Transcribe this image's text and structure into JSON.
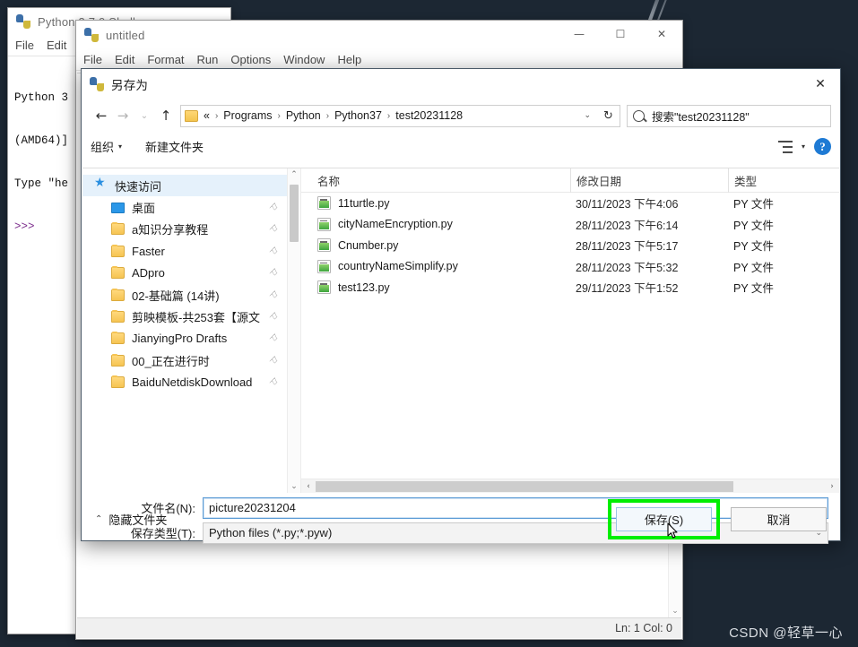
{
  "desktop": {
    "background_color": "#1c2733",
    "watermark": "CSDN @轻草一心"
  },
  "shell_window": {
    "title": "Python 3.7.0 Shell",
    "icon": "python-icon",
    "menu": [
      "File",
      "Edit"
    ],
    "content_lines": [
      "Python 3",
      "(AMD64)]",
      "Type \"he",
      ">>>"
    ]
  },
  "editor_window": {
    "title": "untitled",
    "icon": "python-icon",
    "menu": [
      "File",
      "Edit",
      "Format",
      "Run",
      "Options",
      "Window",
      "Help"
    ],
    "window_buttons": {
      "minimize": "—",
      "maximize": "☐",
      "close": "✕"
    },
    "status": "Ln: 1  Col: 0"
  },
  "dialog": {
    "title": "另存为",
    "icon": "python-icon",
    "close_label": "✕",
    "nav": {
      "back": "←",
      "forward": "→",
      "recent": "⌄",
      "up": "↑",
      "refresh": "↻",
      "dropdown_caret": "⌄"
    },
    "breadcrumb": {
      "prefix": "«",
      "items": [
        "Programs",
        "Python",
        "Python37",
        "test20231128"
      ],
      "separator": "›"
    },
    "search": {
      "icon": "search-icon",
      "placeholder": "搜索\"test20231128\""
    },
    "commandbar": {
      "organize": "组织",
      "organize_caret": "▾",
      "new_folder": "新建文件夹",
      "view_icon": "list-view-icon",
      "view_caret": "▾",
      "help_icon": "help-icon",
      "help_label": "?"
    },
    "nav_pane": {
      "quick_access": {
        "label": "快速访问",
        "icon": "star-icon"
      },
      "items": [
        {
          "label": "桌面",
          "icon": "monitor-icon",
          "pinned": true
        },
        {
          "label": "a知识分享教程",
          "icon": "folder-icon",
          "pinned": true
        },
        {
          "label": "Faster",
          "icon": "folder-icon",
          "pinned": true
        },
        {
          "label": "ADpro",
          "icon": "folder-icon",
          "pinned": true
        },
        {
          "label": "02-基础篇 (14讲)",
          "icon": "folder-icon",
          "pinned": true
        },
        {
          "label": "剪映模板-共253套【源文",
          "icon": "folder-icon",
          "pinned": true
        },
        {
          "label": "JianyingPro Drafts",
          "icon": "folder-icon",
          "pinned": true
        },
        {
          "label": "00_正在进行时",
          "icon": "folder-icon",
          "pinned": true
        },
        {
          "label": "BaiduNetdiskDownload",
          "icon": "folder-icon",
          "pinned": true
        }
      ],
      "pin_glyph": "⚐"
    },
    "file_list": {
      "columns": [
        "名称",
        "修改日期",
        "类型"
      ],
      "rows": [
        {
          "name": "11turtle.py",
          "date": "30/11/2023 下午4:06",
          "type": "PY 文件",
          "icon": "py-file-icon"
        },
        {
          "name": "cityNameEncryption.py",
          "date": "28/11/2023 下午6:14",
          "type": "PY 文件",
          "icon": "py-file-icon"
        },
        {
          "name": "Cnumber.py",
          "date": "28/11/2023 下午5:17",
          "type": "PY 文件",
          "icon": "py-file-icon"
        },
        {
          "name": "countryNameSimplify.py",
          "date": "28/11/2023 下午5:32",
          "type": "PY 文件",
          "icon": "py-file-icon"
        },
        {
          "name": "test123.py",
          "date": "29/11/2023 下午1:52",
          "type": "PY 文件",
          "icon": "py-file-icon"
        }
      ]
    },
    "scrollbars": {
      "up_arrow": "⌃",
      "down_arrow": "⌄",
      "left_arrow": "‹",
      "right_arrow": "›"
    },
    "form": {
      "filename_label": "文件名(N):",
      "filename_value": "picture20231204",
      "filetype_label": "保存类型(T):",
      "filetype_value": "Python files (*.py;*.pyw)",
      "caret": "⌄"
    },
    "footer": {
      "hide_folders_caret": "⌃",
      "hide_folders": "隐藏文件夹",
      "save_button": "保存(S)",
      "cancel_button": "取消",
      "highlight_color": "#00ee00"
    }
  }
}
